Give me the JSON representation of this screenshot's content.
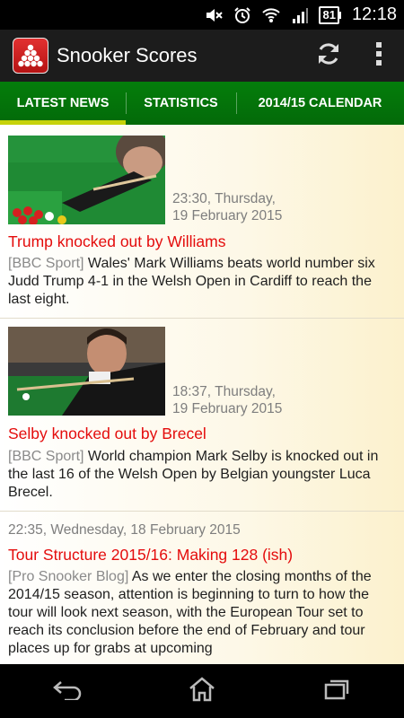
{
  "status_bar": {
    "battery": "81",
    "time": "12:18",
    "icons": [
      "mute-icon",
      "alarm-icon",
      "wifi-icon",
      "signal-icon",
      "battery-icon"
    ]
  },
  "app": {
    "title": "Snooker Scores",
    "icons": [
      "app-logo-icon",
      "refresh-icon",
      "overflow-menu-icon"
    ]
  },
  "tabs": [
    {
      "label": "LATEST NEWS",
      "active": true
    },
    {
      "label": "STATISTICS",
      "active": false
    },
    {
      "label": "2014/15 CALENDAR",
      "active": false
    }
  ],
  "news": [
    {
      "date_line1": "23:30, Thursday,",
      "date_line2": "19 February 2015",
      "title": "Trump knocked out by Williams",
      "source": "[BBC Sport]",
      "summary": " Wales' Mark Williams beats world number six Judd Trump 4-1 in the Welsh Open in Cardiff to reach the last eight."
    },
    {
      "date_line1": "18:37, Thursday,",
      "date_line2": "19 February 2015",
      "title": "Selby knocked out by Brecel",
      "source": "[BBC Sport]",
      "summary": " World champion Mark Selby is knocked out in the last 16 of the Welsh Open by Belgian youngster Luca Brecel."
    },
    {
      "date": "22:35, Wednesday, 18 February 2015",
      "title": "Tour Structure 2015/16: Making 128 (ish)",
      "source": "[Pro Snooker Blog]",
      "summary": " As we enter the closing months of the 2014/15 season, attention is beginning to turn to how the tour will look next season, with the European Tour set to reach its conclusion before the end of February and tour places up for grabs at upcoming"
    }
  ],
  "colors": {
    "tab_bar": "#047d0b",
    "tab_indicator": "#c6d20a",
    "headline": "#e40c0c",
    "action_bar": "#1c1c1c"
  },
  "nav": {
    "icons": [
      "back-icon",
      "home-icon",
      "recent-apps-icon"
    ]
  }
}
